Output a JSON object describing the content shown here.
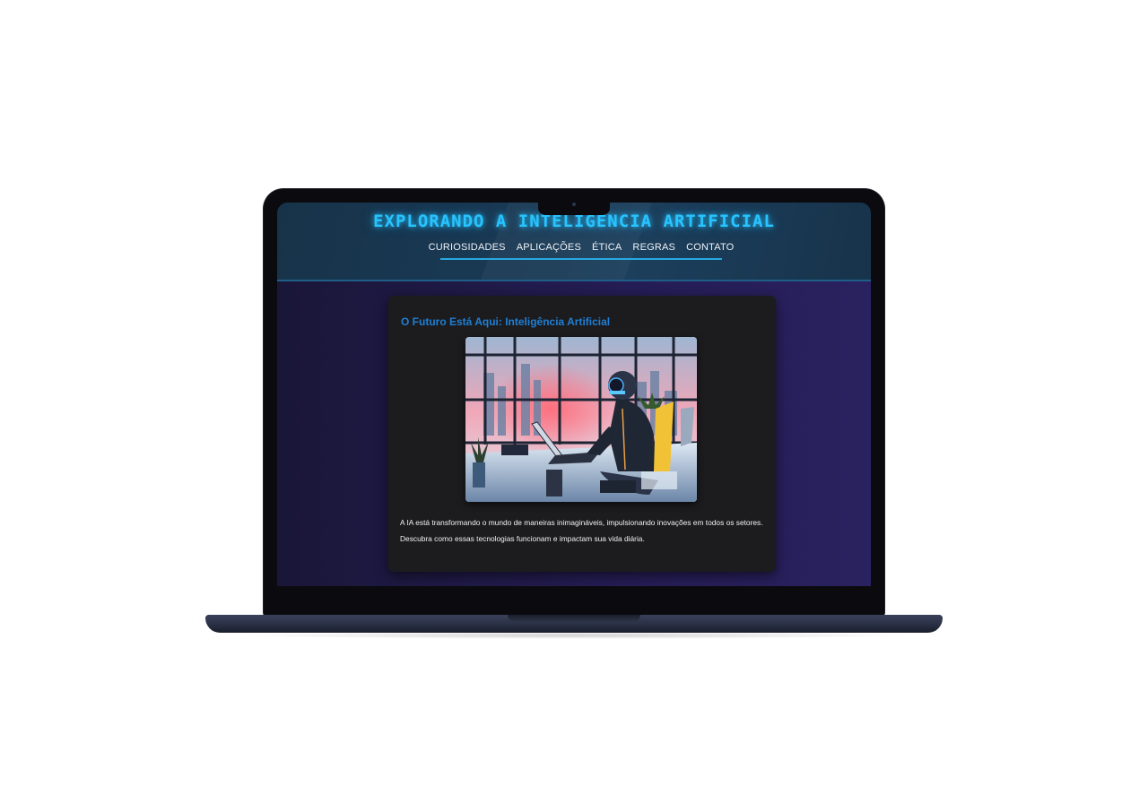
{
  "site": {
    "title": "EXPLORANDO A INTELIGÊNCIA ARTIFICIAL",
    "accent_color": "#27c4ff",
    "nav": [
      {
        "label": "CURIOSIDADES"
      },
      {
        "label": "APLICAÇÕES"
      },
      {
        "label": "ÉTICA"
      },
      {
        "label": "REGRAS"
      },
      {
        "label": "CONTATO"
      }
    ]
  },
  "hero": {
    "heading": "O Futuro Está Aqui: Inteligência Artificial",
    "heading_color": "#1f7fd6",
    "image_icon": "robot-at-laptop-illustration",
    "description": "A IA está transformando o mundo de maneiras inimagináveis, impulsionando inovações em todos os setores. Descubra como essas tecnologias funcionam e impactam sua vida diária."
  }
}
